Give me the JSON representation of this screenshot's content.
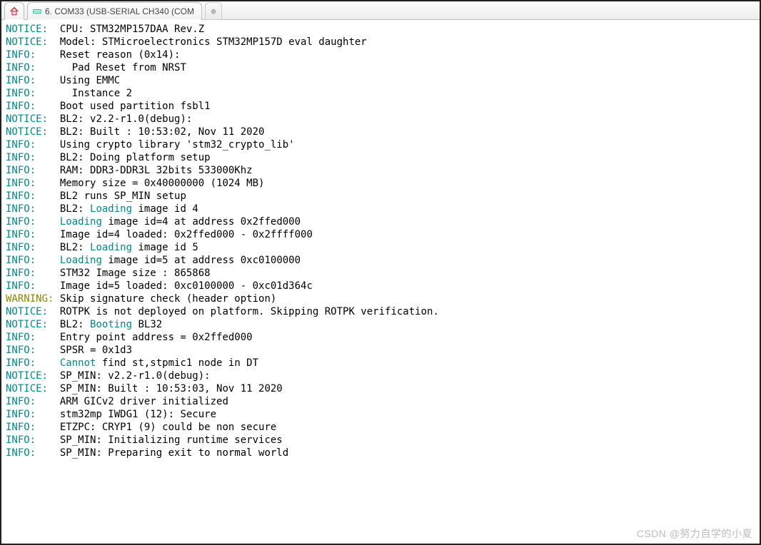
{
  "tabs": {
    "home_title": "Home",
    "serial_title": "6. COM33  (USB-SERIAL CH340 (COM",
    "newtab_glyph": "⊕"
  },
  "watermark": "CSDN @努力自学的小夏",
  "colors": {
    "teal": "#008888",
    "olive": "#8a8a00",
    "text": "#000000"
  },
  "log": [
    {
      "tag": "NOTICE:",
      "tag_class": "c-teal",
      "segments": [
        {
          "t": "  CPU: STM32MP157DAA Rev.Z",
          "c": "c-black"
        }
      ]
    },
    {
      "tag": "NOTICE:",
      "tag_class": "c-teal",
      "segments": [
        {
          "t": "  Model: STMicroelectronics STM32MP157D eval daughter",
          "c": "c-black"
        }
      ]
    },
    {
      "tag": "INFO:",
      "tag_class": "c-teal",
      "segments": [
        {
          "t": "    Reset reason (0x14):",
          "c": "c-black"
        }
      ]
    },
    {
      "tag": "INFO:",
      "tag_class": "c-teal",
      "segments": [
        {
          "t": "      Pad Reset from NRST",
          "c": "c-black"
        }
      ]
    },
    {
      "tag": "INFO:",
      "tag_class": "c-teal",
      "segments": [
        {
          "t": "    Using EMMC",
          "c": "c-black"
        }
      ]
    },
    {
      "tag": "INFO:",
      "tag_class": "c-teal",
      "segments": [
        {
          "t": "      Instance 2",
          "c": "c-black"
        }
      ]
    },
    {
      "tag": "INFO:",
      "tag_class": "c-teal",
      "segments": [
        {
          "t": "    Boot used partition fsbl1",
          "c": "c-black"
        }
      ]
    },
    {
      "tag": "NOTICE:",
      "tag_class": "c-teal",
      "segments": [
        {
          "t": "  BL2: v2.2-r1.0(debug):",
          "c": "c-black"
        }
      ]
    },
    {
      "tag": "NOTICE:",
      "tag_class": "c-teal",
      "segments": [
        {
          "t": "  BL2: Built : 10:53:02, Nov 11 2020",
          "c": "c-black"
        }
      ]
    },
    {
      "tag": "INFO:",
      "tag_class": "c-teal",
      "segments": [
        {
          "t": "    Using crypto library 'stm32_crypto_lib'",
          "c": "c-black"
        }
      ]
    },
    {
      "tag": "INFO:",
      "tag_class": "c-teal",
      "segments": [
        {
          "t": "    BL2: Doing platform setup",
          "c": "c-black"
        }
      ]
    },
    {
      "tag": "INFO:",
      "tag_class": "c-teal",
      "segments": [
        {
          "t": "    RAM: DDR3-DDR3L 32bits 533000Khz",
          "c": "c-black"
        }
      ]
    },
    {
      "tag": "INFO:",
      "tag_class": "c-teal",
      "segments": [
        {
          "t": "    Memory size = 0x40000000 (1024 MB)",
          "c": "c-black"
        }
      ]
    },
    {
      "tag": "INFO:",
      "tag_class": "c-teal",
      "segments": [
        {
          "t": "    BL2 runs SP_MIN setup",
          "c": "c-black"
        }
      ]
    },
    {
      "tag": "INFO:",
      "tag_class": "c-teal",
      "segments": [
        {
          "t": "    BL2: ",
          "c": "c-black"
        },
        {
          "t": "Loading",
          "c": "c-kw"
        },
        {
          "t": " image id 4",
          "c": "c-black"
        }
      ]
    },
    {
      "tag": "INFO:",
      "tag_class": "c-teal",
      "segments": [
        {
          "t": "    ",
          "c": "c-black"
        },
        {
          "t": "Loading",
          "c": "c-kw"
        },
        {
          "t": " image id=4 at address 0x2ffed000",
          "c": "c-black"
        }
      ]
    },
    {
      "tag": "INFO:",
      "tag_class": "c-teal",
      "segments": [
        {
          "t": "    Image id=4 loaded: 0x2ffed000 - 0x2ffff000",
          "c": "c-black"
        }
      ]
    },
    {
      "tag": "INFO:",
      "tag_class": "c-teal",
      "segments": [
        {
          "t": "    BL2: ",
          "c": "c-black"
        },
        {
          "t": "Loading",
          "c": "c-kw"
        },
        {
          "t": " image id 5",
          "c": "c-black"
        }
      ]
    },
    {
      "tag": "INFO:",
      "tag_class": "c-teal",
      "segments": [
        {
          "t": "    ",
          "c": "c-black"
        },
        {
          "t": "Loading",
          "c": "c-kw"
        },
        {
          "t": " image id=5 at address 0xc0100000",
          "c": "c-black"
        }
      ]
    },
    {
      "tag": "INFO:",
      "tag_class": "c-teal",
      "segments": [
        {
          "t": "    STM32 Image size : 865868",
          "c": "c-black"
        }
      ]
    },
    {
      "tag": "INFO:",
      "tag_class": "c-teal",
      "segments": [
        {
          "t": "    Image id=5 loaded: 0xc0100000 - 0xc01d364c",
          "c": "c-black"
        }
      ]
    },
    {
      "tag": "WARNING:",
      "tag_class": "c-olive",
      "segments": [
        {
          "t": " Skip signature check (header option)",
          "c": "c-black"
        }
      ]
    },
    {
      "tag": "NOTICE:",
      "tag_class": "c-teal",
      "segments": [
        {
          "t": "  ROTPK is not deployed on platform. Skipping ROTPK verification.",
          "c": "c-black"
        }
      ]
    },
    {
      "tag": "NOTICE:",
      "tag_class": "c-teal",
      "segments": [
        {
          "t": "  BL2: ",
          "c": "c-black"
        },
        {
          "t": "Booting",
          "c": "c-kw"
        },
        {
          "t": " BL32",
          "c": "c-black"
        }
      ]
    },
    {
      "tag": "INFO:",
      "tag_class": "c-teal",
      "segments": [
        {
          "t": "    Entry point address = 0x2ffed000",
          "c": "c-black"
        }
      ]
    },
    {
      "tag": "INFO:",
      "tag_class": "c-teal",
      "segments": [
        {
          "t": "    SPSR = 0x1d3",
          "c": "c-black"
        }
      ]
    },
    {
      "tag": "INFO:",
      "tag_class": "c-teal",
      "segments": [
        {
          "t": "    ",
          "c": "c-black"
        },
        {
          "t": "Cannot",
          "c": "c-kw"
        },
        {
          "t": " find st,stpmic1 node in DT",
          "c": "c-black"
        }
      ]
    },
    {
      "tag": "NOTICE:",
      "tag_class": "c-teal",
      "segments": [
        {
          "t": "  SP_MIN: v2.2-r1.0(debug):",
          "c": "c-black"
        }
      ]
    },
    {
      "tag": "NOTICE:",
      "tag_class": "c-teal",
      "segments": [
        {
          "t": "  SP_MIN: Built : 10:53:03, Nov 11 2020",
          "c": "c-black"
        }
      ]
    },
    {
      "tag": "INFO:",
      "tag_class": "c-teal",
      "segments": [
        {
          "t": "    ARM GICv2 driver initialized",
          "c": "c-black"
        }
      ]
    },
    {
      "tag": "INFO:",
      "tag_class": "c-teal",
      "segments": [
        {
          "t": "    stm32mp IWDG1 (12): Secure",
          "c": "c-black"
        }
      ]
    },
    {
      "tag": "INFO:",
      "tag_class": "c-teal",
      "segments": [
        {
          "t": "    ETZPC: CRYP1 (9) could be non secure",
          "c": "c-black"
        }
      ]
    },
    {
      "tag": "INFO:",
      "tag_class": "c-teal",
      "segments": [
        {
          "t": "    SP_MIN: Initializing runtime services",
          "c": "c-black"
        }
      ]
    },
    {
      "tag": "INFO:",
      "tag_class": "c-teal",
      "segments": [
        {
          "t": "    SP_MIN: Preparing exit to normal world",
          "c": "c-black"
        }
      ]
    }
  ]
}
